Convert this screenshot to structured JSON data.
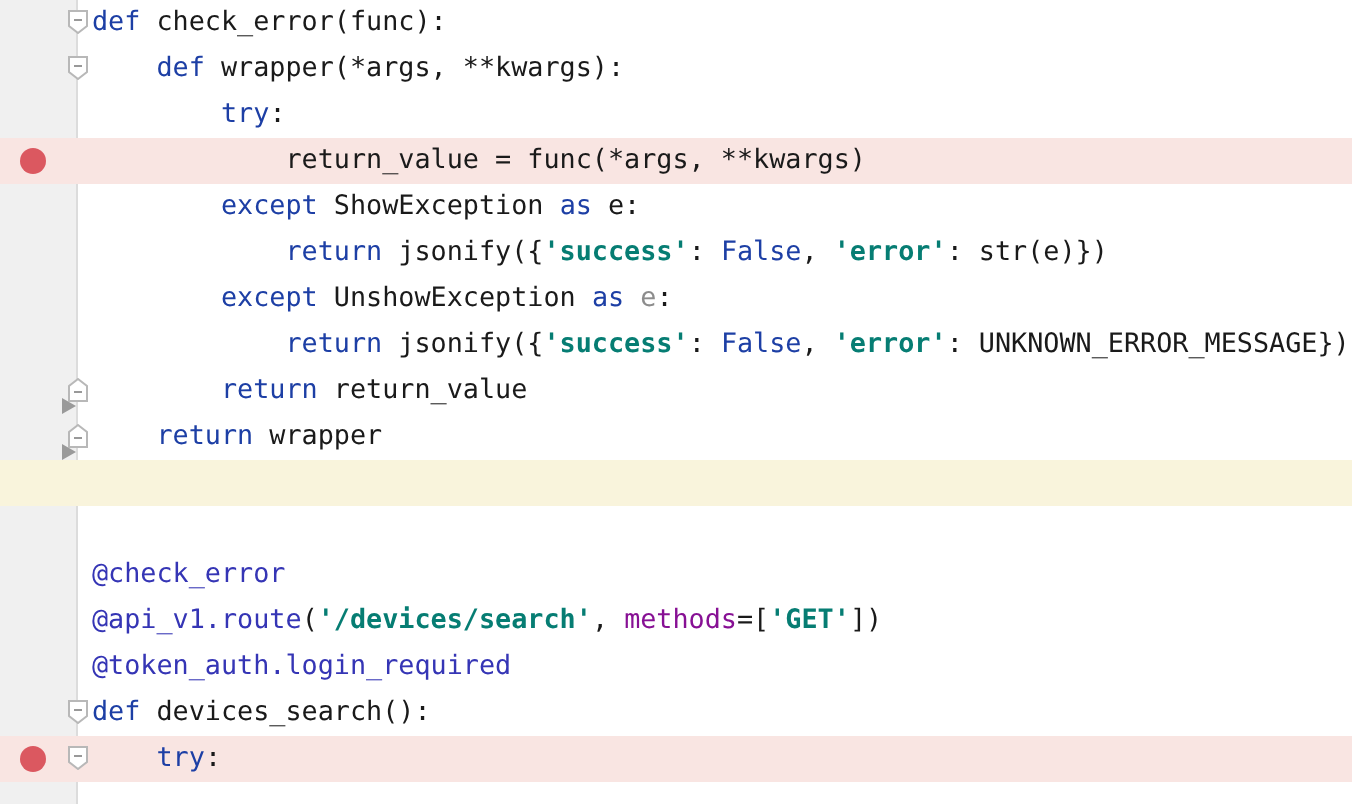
{
  "editor": {
    "lines": [
      {
        "breakpoint": false,
        "current": false,
        "fold_start": true,
        "fold_end": false,
        "arrow": false,
        "tokens": [
          {
            "kind": "keyword",
            "text": "def"
          },
          {
            "kind": "plain",
            "text": " check_error(func):"
          }
        ]
      },
      {
        "breakpoint": false,
        "current": false,
        "fold_start": true,
        "fold_end": false,
        "arrow": false,
        "tokens": [
          {
            "kind": "keyword",
            "text": "    def"
          },
          {
            "kind": "plain",
            "text": " wrapper(*args, **kwargs):"
          }
        ]
      },
      {
        "breakpoint": false,
        "current": false,
        "fold_start": false,
        "fold_end": false,
        "arrow": false,
        "tokens": [
          {
            "kind": "keyword",
            "text": "        try"
          },
          {
            "kind": "plain",
            "text": ":"
          }
        ]
      },
      {
        "breakpoint": true,
        "current": false,
        "fold_start": false,
        "fold_end": false,
        "arrow": false,
        "tokens": [
          {
            "kind": "plain",
            "text": "            return_value = func(*args, **kwargs)"
          }
        ]
      },
      {
        "breakpoint": false,
        "current": false,
        "fold_start": false,
        "fold_end": false,
        "arrow": false,
        "tokens": [
          {
            "kind": "keyword",
            "text": "        except"
          },
          {
            "kind": "plain",
            "text": " ShowException "
          },
          {
            "kind": "keyword",
            "text": "as"
          },
          {
            "kind": "plain",
            "text": " e:"
          }
        ]
      },
      {
        "breakpoint": false,
        "current": false,
        "fold_start": false,
        "fold_end": false,
        "arrow": false,
        "tokens": [
          {
            "kind": "keyword",
            "text": "            return"
          },
          {
            "kind": "plain",
            "text": " jsonify({"
          },
          {
            "kind": "string",
            "text": "'success'"
          },
          {
            "kind": "plain",
            "text": ": "
          },
          {
            "kind": "keyword",
            "text": "False"
          },
          {
            "kind": "plain",
            "text": ", "
          },
          {
            "kind": "string",
            "text": "'error'"
          },
          {
            "kind": "plain",
            "text": ": str(e)})"
          }
        ]
      },
      {
        "breakpoint": false,
        "current": false,
        "fold_start": false,
        "fold_end": false,
        "arrow": false,
        "tokens": [
          {
            "kind": "keyword",
            "text": "        except"
          },
          {
            "kind": "plain",
            "text": " UnshowException "
          },
          {
            "kind": "keyword",
            "text": "as"
          },
          {
            "kind": "unused",
            "text": " e"
          },
          {
            "kind": "plain",
            "text": ":"
          }
        ]
      },
      {
        "breakpoint": false,
        "current": false,
        "fold_start": false,
        "fold_end": false,
        "arrow": false,
        "tokens": [
          {
            "kind": "keyword",
            "text": "            return"
          },
          {
            "kind": "plain",
            "text": " jsonify({"
          },
          {
            "kind": "string",
            "text": "'success'"
          },
          {
            "kind": "plain",
            "text": ": "
          },
          {
            "kind": "keyword",
            "text": "False"
          },
          {
            "kind": "plain",
            "text": ", "
          },
          {
            "kind": "string",
            "text": "'error'"
          },
          {
            "kind": "plain",
            "text": ": UNKNOWN_ERROR_MESSAGE})"
          }
        ]
      },
      {
        "breakpoint": false,
        "current": false,
        "fold_start": false,
        "fold_end": true,
        "arrow": true,
        "tokens": [
          {
            "kind": "keyword",
            "text": "        return"
          },
          {
            "kind": "plain",
            "text": " return_value"
          }
        ]
      },
      {
        "breakpoint": false,
        "current": false,
        "fold_start": false,
        "fold_end": true,
        "arrow": true,
        "tokens": [
          {
            "kind": "keyword",
            "text": "    return"
          },
          {
            "kind": "plain",
            "text": " wrapper"
          }
        ]
      },
      {
        "breakpoint": false,
        "current": true,
        "fold_start": false,
        "fold_end": false,
        "arrow": false
      },
      {
        "breakpoint": false,
        "current": false,
        "fold_start": false,
        "fold_end": false,
        "arrow": false
      },
      {
        "breakpoint": false,
        "current": false,
        "fold_start": false,
        "fold_end": false,
        "arrow": false,
        "tokens": [
          {
            "kind": "decorator",
            "text": "@check_error"
          }
        ]
      },
      {
        "breakpoint": false,
        "current": false,
        "fold_start": false,
        "fold_end": false,
        "arrow": false,
        "tokens": [
          {
            "kind": "decorator",
            "text": "@api_v1.route"
          },
          {
            "kind": "plain",
            "text": "("
          },
          {
            "kind": "string",
            "text": "'/devices/search'"
          },
          {
            "kind": "plain",
            "text": ", "
          },
          {
            "kind": "param",
            "text": "methods"
          },
          {
            "kind": "plain",
            "text": "=["
          },
          {
            "kind": "string",
            "text": "'GET'"
          },
          {
            "kind": "plain",
            "text": "])"
          }
        ]
      },
      {
        "breakpoint": false,
        "current": false,
        "fold_start": false,
        "fold_end": false,
        "arrow": false,
        "tokens": [
          {
            "kind": "decorator",
            "text": "@token_auth.login_required"
          }
        ]
      },
      {
        "breakpoint": false,
        "current": false,
        "fold_start": true,
        "fold_end": false,
        "arrow": false,
        "tokens": [
          {
            "kind": "keyword",
            "text": "def"
          },
          {
            "kind": "plain",
            "text": " devices_search():"
          }
        ]
      },
      {
        "breakpoint": true,
        "current": false,
        "fold_start": true,
        "fold_end": false,
        "arrow": false,
        "tokens": [
          {
            "kind": "keyword",
            "text": "    try"
          },
          {
            "kind": "plain",
            "text": ":"
          }
        ]
      }
    ]
  }
}
